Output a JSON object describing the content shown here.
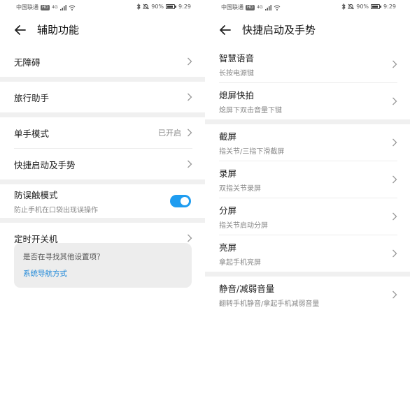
{
  "left": {
    "status": {
      "carrier": "中国联通",
      "hd": "HD",
      "network": "4G",
      "battery": "90%",
      "time": "9:29"
    },
    "header": {
      "title": "辅助功能"
    },
    "items": [
      {
        "label": "无障碍"
      },
      {
        "label": "旅行助手"
      },
      {
        "label": "单手模式",
        "value": "已开启"
      },
      {
        "label": "快捷启动及手势"
      },
      {
        "label": "防误触模式",
        "sub": "防止手机在口袋出现误操作",
        "toggle": "on"
      },
      {
        "label": "定时开关机"
      }
    ],
    "suggestion": {
      "question": "是否在寻找其他设置项？",
      "link": "系统导航方式"
    }
  },
  "right": {
    "status": {
      "carrier": "中国联通",
      "hd": "HD",
      "network": "4G",
      "battery": "90%",
      "time": "9:29"
    },
    "header": {
      "title": "快捷启动及手势"
    },
    "items": [
      {
        "label": "智慧语音",
        "sub": "长按电源键"
      },
      {
        "label": "熄屏快拍",
        "sub": "熄屏下双击音量下键"
      },
      {
        "label": "截屏",
        "sub": "指关节/三指下滑截屏"
      },
      {
        "label": "录屏",
        "sub": "双指关节录屏"
      },
      {
        "label": "分屏",
        "sub": "指关节启动分屏"
      },
      {
        "label": "亮屏",
        "sub": "拿起手机亮屏"
      },
      {
        "label": "静音/减弱音量",
        "sub": "翻转手机静音/拿起手机减弱音量"
      }
    ]
  },
  "colors": {
    "accent": "#1e9cf0",
    "link": "#1e88d8",
    "separator": "#f0f0f0",
    "card": "#ededed"
  },
  "icons": [
    "back-arrow-icon",
    "chevron-right-icon",
    "bluetooth-icon",
    "mute-icon",
    "signal-icon",
    "wifi-icon",
    "battery-icon"
  ]
}
